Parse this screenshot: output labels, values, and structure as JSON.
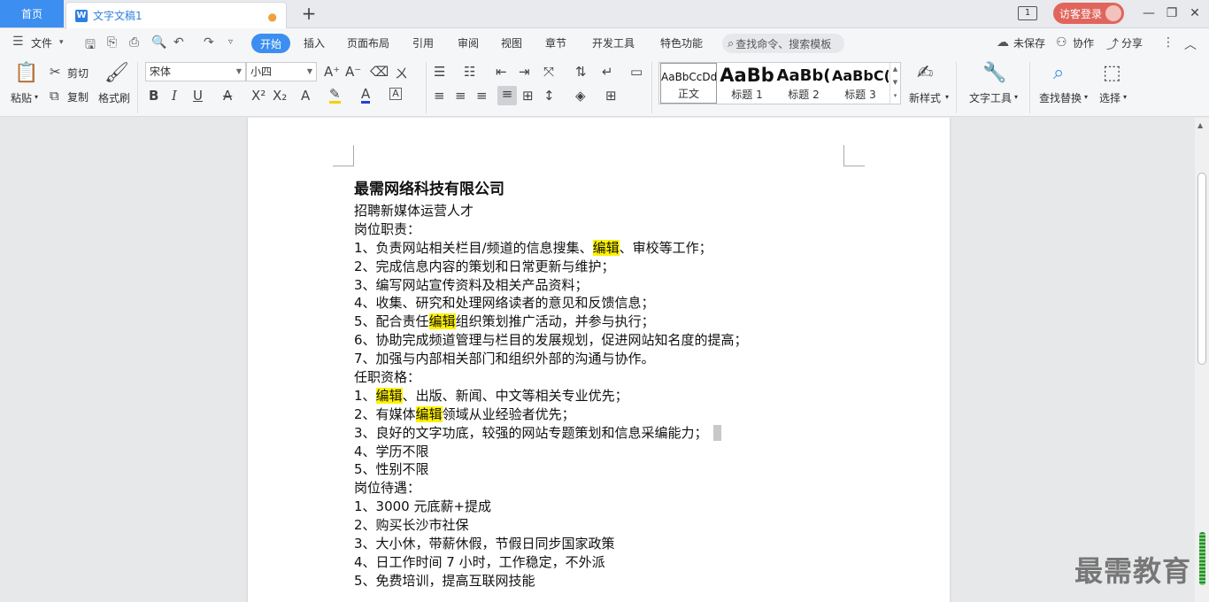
{
  "tabbar": {
    "home": "首页",
    "doc_tab": "文字文稿1",
    "login": "访客登录"
  },
  "menu": {
    "file": "文件",
    "tabs": [
      "开始",
      "插入",
      "页面布局",
      "引用",
      "审阅",
      "视图",
      "章节",
      "开发工具",
      "特色功能"
    ],
    "search_placeholder": "查找命令、搜索模板",
    "unsaved": "未保存",
    "collab": "协作",
    "share": "分享"
  },
  "ribbon": {
    "paste": "粘贴",
    "cut": "剪切",
    "copy": "复制",
    "format_painter": "格式刷",
    "font_name": "宋体",
    "font_size": "小四",
    "styles": [
      {
        "preview": "AaBbCcDd",
        "name": "正文"
      },
      {
        "preview": "AaBb",
        "name": "标题 1"
      },
      {
        "preview": "AaBb(",
        "name": "标题 2"
      },
      {
        "preview": "AaBbC(",
        "name": "标题 3"
      }
    ],
    "new_style": "新样式",
    "text_tools": "文字工具",
    "find_replace": "查找替换",
    "select": "选择"
  },
  "document": {
    "title": "最需网络科技有限公司",
    "lines": [
      {
        "pre": "招聘新媒体运营人才"
      },
      {
        "pre": "岗位职责："
      },
      {
        "pre": "1、负责网站相关栏目/频道的信息搜集、",
        "hl": "编辑",
        "post": "、审校等工作；"
      },
      {
        "pre": "2、完成信息内容的策划和日常更新与维护；"
      },
      {
        "pre": "3、编写网站宣传资料及相关产品资料；"
      },
      {
        "pre": "4、收集、研究和处理网络读者的意见和反馈信息；"
      },
      {
        "pre": "5、配合责任",
        "hl": "编辑",
        "post": "组织策划推广活动，并参与执行；"
      },
      {
        "pre": "6、协助完成频道管理与栏目的发展规划，促进网站知名度的提高；"
      },
      {
        "pre": "7、加强与内部相关部门和组织外部的沟通与协作。"
      },
      {
        "pre": "任职资格："
      },
      {
        "pre": "1、",
        "hl": "编辑",
        "post": "、出版、新闻、中文等相关专业优先；"
      },
      {
        "pre": "2、有媒体",
        "hl": "编辑",
        "post": "领域从业经验者优先；"
      },
      {
        "pre": "3、良好的文字功底，较强的网站专题策划和信息采编能力；"
      },
      {
        "pre": "4、学历不限"
      },
      {
        "pre": "5、性别不限"
      },
      {
        "pre": "岗位待遇："
      },
      {
        "pre": "1、3000 元底薪+提成"
      },
      {
        "pre": "2、购买长沙市社保"
      },
      {
        "pre": "3、大小休，带薪休假，节假日同步国家政策"
      },
      {
        "pre": "4、日工作时间 7 小时，工作稳定，不外派"
      },
      {
        "pre": "5、免费培训，提高互联网技能"
      }
    ]
  },
  "watermark": "最需教育"
}
